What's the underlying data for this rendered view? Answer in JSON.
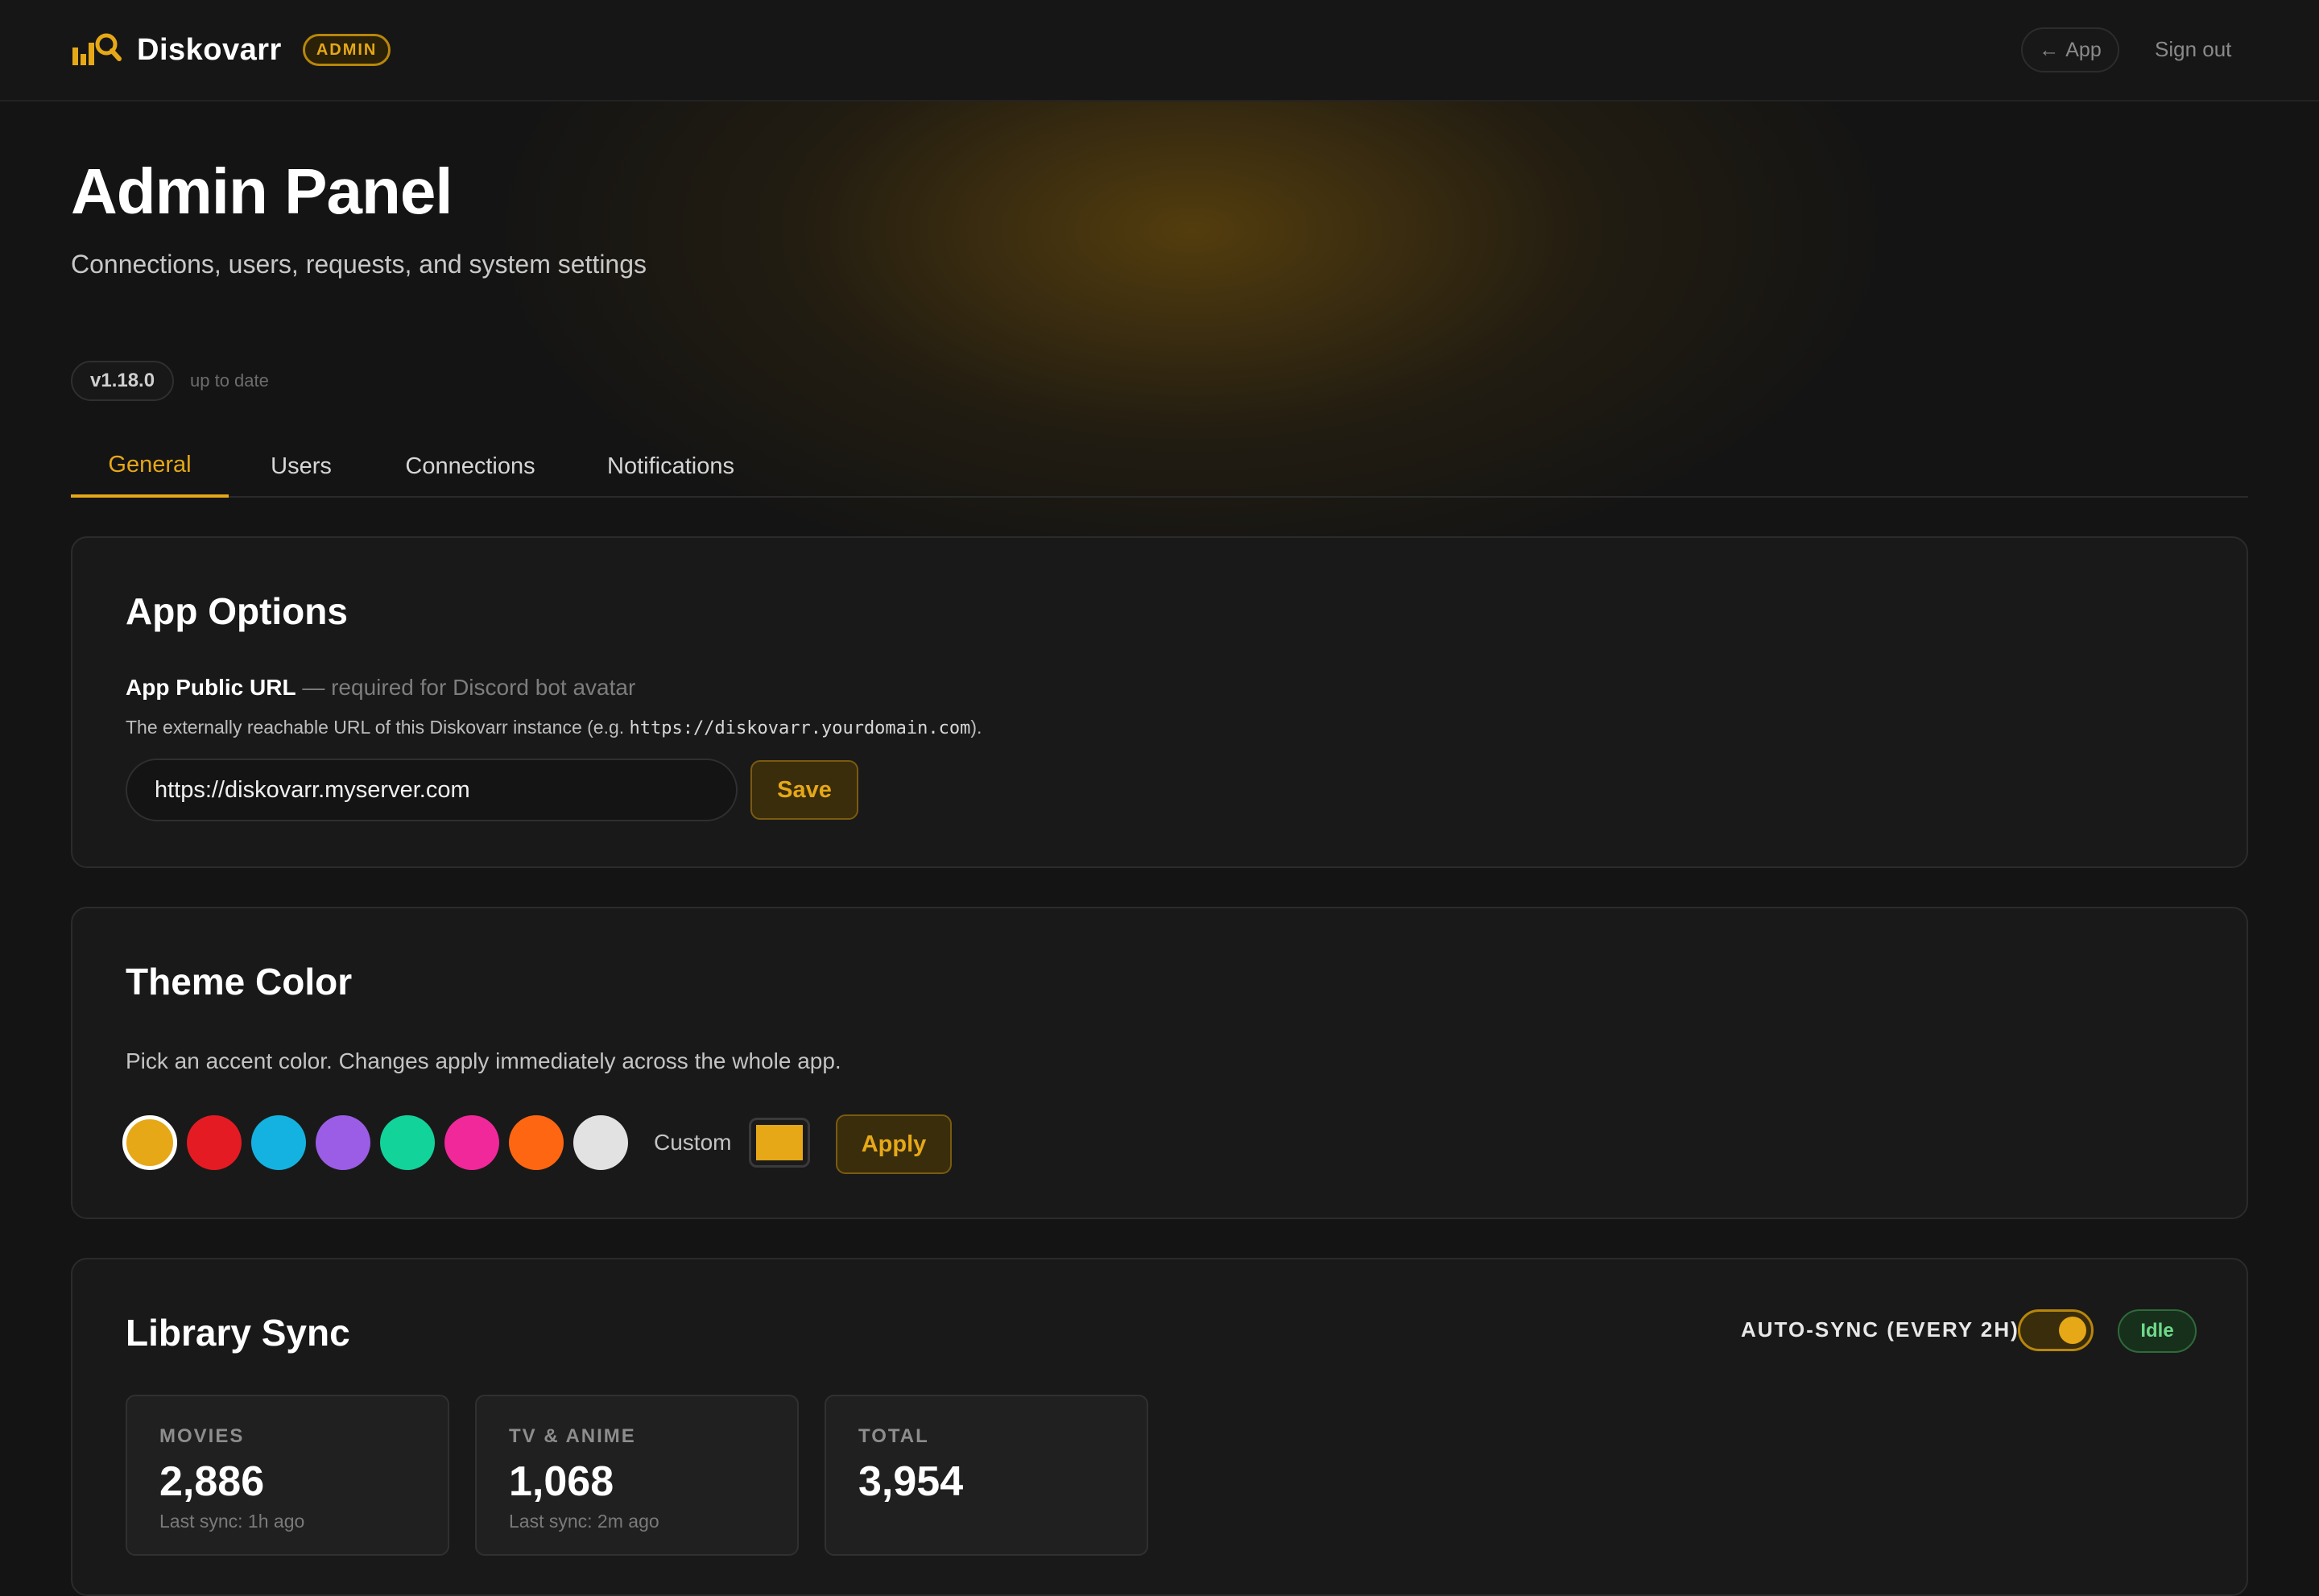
{
  "app": {
    "name": "Diskovarr",
    "badge": "ADMIN"
  },
  "topbar": {
    "back_icon": "←",
    "back_label": "App",
    "signout_label": "Sign out"
  },
  "header": {
    "title": "Admin Panel",
    "subtitle": "Connections, users, requests, and system settings",
    "version": "v1.18.0",
    "version_status": "up to date"
  },
  "tabs": [
    {
      "label": "General",
      "active": true
    },
    {
      "label": "Users",
      "active": false
    },
    {
      "label": "Connections",
      "active": false
    },
    {
      "label": "Notifications",
      "active": false
    }
  ],
  "app_options": {
    "title": "App Options",
    "field_label": "App Public URL",
    "field_hint": "— required for Discord bot avatar",
    "desc_before": "The externally reachable URL of this Diskovarr instance (e.g. ",
    "desc_code": "https://diskovarr.yourdomain.com",
    "desc_after": ").",
    "url_value": "https://diskovarr.myserver.com",
    "save_label": "Save"
  },
  "theme": {
    "title": "Theme Color",
    "desc": "Pick an accent color. Changes apply immediately across the whole app.",
    "swatches": [
      "#e6a817",
      "#e51b23",
      "#14b2e0",
      "#9b5de5",
      "#12d39a",
      "#f0289a",
      "#ff6612",
      "#e2e2e2"
    ],
    "selected_index": 0,
    "custom_label": "Custom",
    "custom_color": "#e6a817",
    "apply_label": "Apply"
  },
  "library_sync": {
    "title": "Library Sync",
    "autosync_label": "AUTO-SYNC (EVERY 2H)",
    "autosync_on": true,
    "status": "Idle",
    "stats": [
      {
        "label": "MOVIES",
        "value": "2,886",
        "sub": "Last sync: 1h ago"
      },
      {
        "label": "TV & ANIME",
        "value": "1,068",
        "sub": "Last sync: 2m ago"
      },
      {
        "label": "TOTAL",
        "value": "3,954",
        "sub": ""
      }
    ]
  },
  "colors": {
    "accent": "#e6a817",
    "background": "#141414",
    "card": "#1a1a1a",
    "status_ok": "#6fd88a"
  }
}
